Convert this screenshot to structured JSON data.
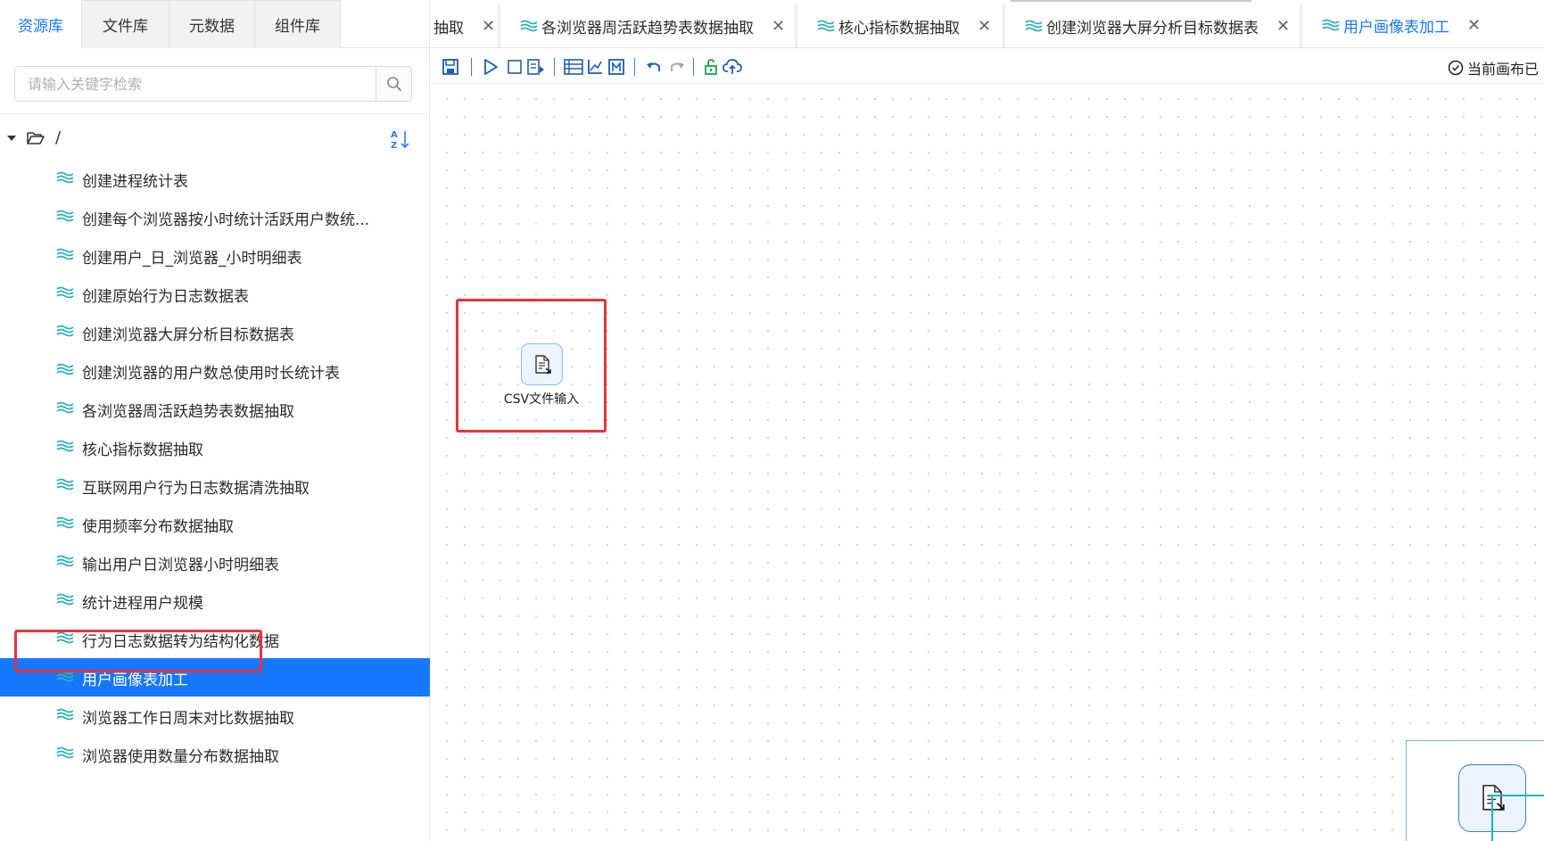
{
  "left_panel": {
    "tabs": [
      {
        "label": "资源库",
        "active": true
      },
      {
        "label": "文件库",
        "active": false
      },
      {
        "label": "元数据",
        "active": false
      },
      {
        "label": "组件库",
        "active": false
      }
    ],
    "search": {
      "placeholder": "请输入关键字检索",
      "value": ""
    },
    "tree": {
      "root_label": "/",
      "items": [
        {
          "label": "创建进程统计表"
        },
        {
          "label": "创建每个浏览器按小时统计活跃用户数统..."
        },
        {
          "label": "创建用户_日_浏览器_小时明细表"
        },
        {
          "label": "创建原始行为日志数据表"
        },
        {
          "label": "创建浏览器大屏分析目标数据表"
        },
        {
          "label": "创建浏览器的用户数总使用时长统计表"
        },
        {
          "label": "各浏览器周活跃趋势表数据抽取"
        },
        {
          "label": "核心指标数据抽取"
        },
        {
          "label": "互联网用户行为日志数据清洗抽取"
        },
        {
          "label": "使用频率分布数据抽取"
        },
        {
          "label": "输出用户日浏览器小时明细表"
        },
        {
          "label": "统计进程用户规模"
        },
        {
          "label": "行为日志数据转为结构化数据"
        },
        {
          "label": "用户画像表加工",
          "selected": true
        },
        {
          "label": "浏览器工作日周末对比数据抽取"
        },
        {
          "label": "浏览器使用数量分布数据抽取"
        }
      ]
    }
  },
  "doc_tabs": [
    {
      "label": "抽取",
      "active": false
    },
    {
      "label": "各浏览器周活跃趋势表数据抽取",
      "active": false
    },
    {
      "label": "核心指标数据抽取",
      "active": false
    },
    {
      "label": "创建浏览器大屏分析目标数据表",
      "active": false
    },
    {
      "label": "用户画像表加工",
      "active": true
    }
  ],
  "toolbar": {
    "status_text": "当前画布已"
  },
  "canvas": {
    "node_label": "CSV文件输入"
  },
  "colors": {
    "accent": "#1677ff",
    "highlight": "#e8323c",
    "layer_icon": "#2bb3b1"
  }
}
